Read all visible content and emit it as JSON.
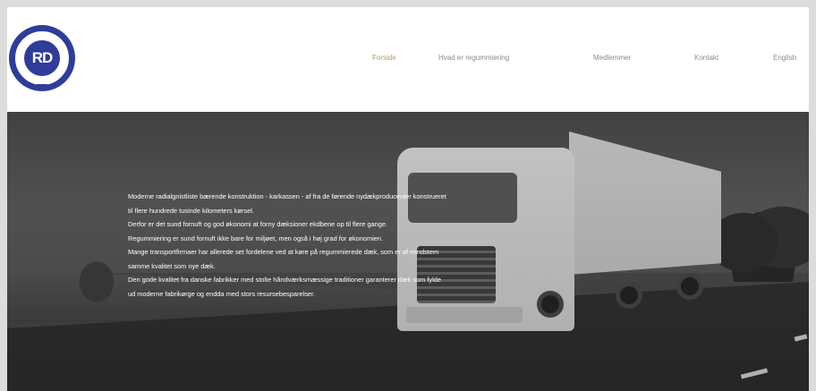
{
  "header": {
    "logo_text": "RD",
    "nav": [
      {
        "label": "Forside",
        "active": true
      },
      {
        "label": "Hvad er regummiering",
        "active": false
      },
      {
        "label": "Medlemmer",
        "active": false
      },
      {
        "label": "Kontakt",
        "active": false
      },
      {
        "label": "English",
        "active": false
      }
    ]
  },
  "hero": {
    "paragraphs": [
      "Moderne radialgnistliste bærende konstruktion - karkassen - af fra de førende nydækproducenter konstrueret til flere hundrede tusinde kilometers kørsel.",
      "Derfor er det sund fornuft og god økonomi at forny dæksioner ekdbene op til flere gange.",
      "Regummiering er sund fornuft ikke bare for miljøet, men også i høj grad for økonomien.",
      "Mange transportfirmaer har allerede set fordelene ved at køre på regummierede dæk, som er af mindstem samme kvalitet som nye dæk.",
      "Den gode kvalitet fra danske fabrikker med stolte håndværksmæssige traditioner garanterer dæk som fylde ud moderne fabrikørge og endda med stors resursebesparelser."
    ]
  },
  "colors": {
    "nav_active": "#b59a55",
    "nav_default": "#8a8a8a",
    "logo_blue": "#2f3c9a"
  }
}
